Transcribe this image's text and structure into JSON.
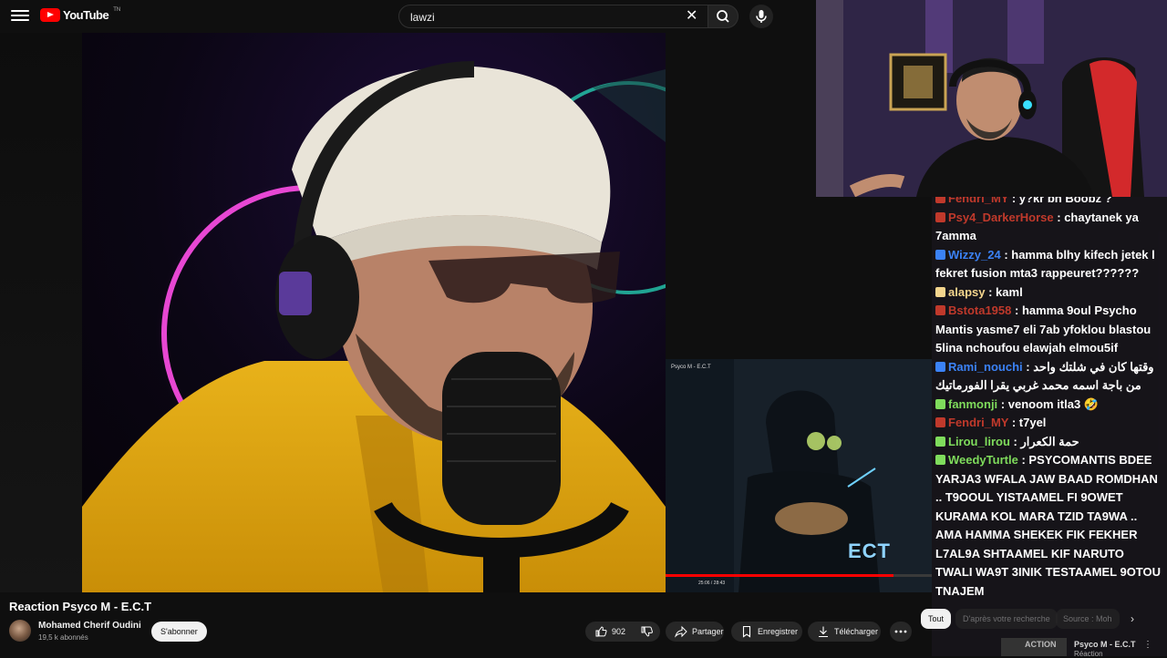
{
  "header": {
    "logo_text": "YouTube",
    "logo_sup": "TN",
    "search_value": "lawzi",
    "clear_glyph": "✕"
  },
  "video": {
    "title": "Reaction Psyco M - E.C.T",
    "channel_name": "Mohamed Cherif Oudini",
    "subscribers": "19,5 k abonnés",
    "subscribe_label": "S'abonner",
    "like_count": "902",
    "share_label": "Partager",
    "save_label": "Enregistrer",
    "download_label": "Télécharger"
  },
  "inset": {
    "title": "Psyco M - E.C.T",
    "time": "25:06 / 28:43",
    "art_text": "ECT"
  },
  "chat": {
    "messages": [
      {
        "user": "Fendri_MY",
        "text": ": y?kr bh Boobz ?",
        "color": "#c0392b"
      },
      {
        "user": "Psy4_DarkerHorse",
        "text": ": chaytanek ya 7amma",
        "color": "#c0392b"
      },
      {
        "user": "Wizzy_24",
        "text": ": hamma blhy kifech jetek l fekret fusion mta3 rappeuret??????",
        "color": "#3b82f6"
      },
      {
        "user": "alapsy",
        "text": ": kaml",
        "color": "#f4d58d"
      },
      {
        "user": "Bstota1958",
        "text": ": hamma 9oul Psycho Mantis yasme7 eli 7ab yfoklou blastou 5lina nchoufou elawjah elmou5if",
        "color": "#c0392b"
      },
      {
        "user": "Rami_nouchi",
        "text": ": وقتها كان في شلتك واحد من باجة اسمه محمد غربي يقرا الفورماتيك",
        "color": "#3b82f6"
      },
      {
        "user": "fanmonji",
        "text": ": venoom itla3 🤣",
        "color": "#7fdc5c"
      },
      {
        "user": "Fendri_MY",
        "text": ": t7yel",
        "color": "#c0392b"
      },
      {
        "user": "Lirou_lirou",
        "text": ": حمة الكعرار",
        "color": "#7fdc5c"
      },
      {
        "user": "WeedyTurtle",
        "text": ": PSYCOMANTIS BDEE YARJA3 WFALA JAW BAAD ROMDHAN .. T9OOUL YISTAAMEL FI 9OWET KURAMA KOL MARA TZID TA9WA .. AMA HAMMA SHEKEK FIK FEKHER L7AL9A SHTAAMEL KIF NARUTO TWALI WA9T 3INIK TESTAAMEL 9OTOU TNAJEM",
        "color": "#7fdc5c"
      }
    ]
  },
  "suggestions": {
    "chip_all": "Tout",
    "chip_search": "D'après votre recherche",
    "chip_source": "Source : Moh",
    "next_title": "Psyco M - E.C.T",
    "next_sub": "Réaction",
    "next_thumb_text": "ACTION"
  },
  "icons": {
    "menu": "menu-icon",
    "search": "search-icon",
    "mic": "mic-icon",
    "like": "thumbs-up-icon",
    "dislike": "thumbs-down-icon",
    "share": "share-icon",
    "save": "bookmark-icon",
    "download": "download-icon",
    "more": "more-horizontal-icon"
  }
}
